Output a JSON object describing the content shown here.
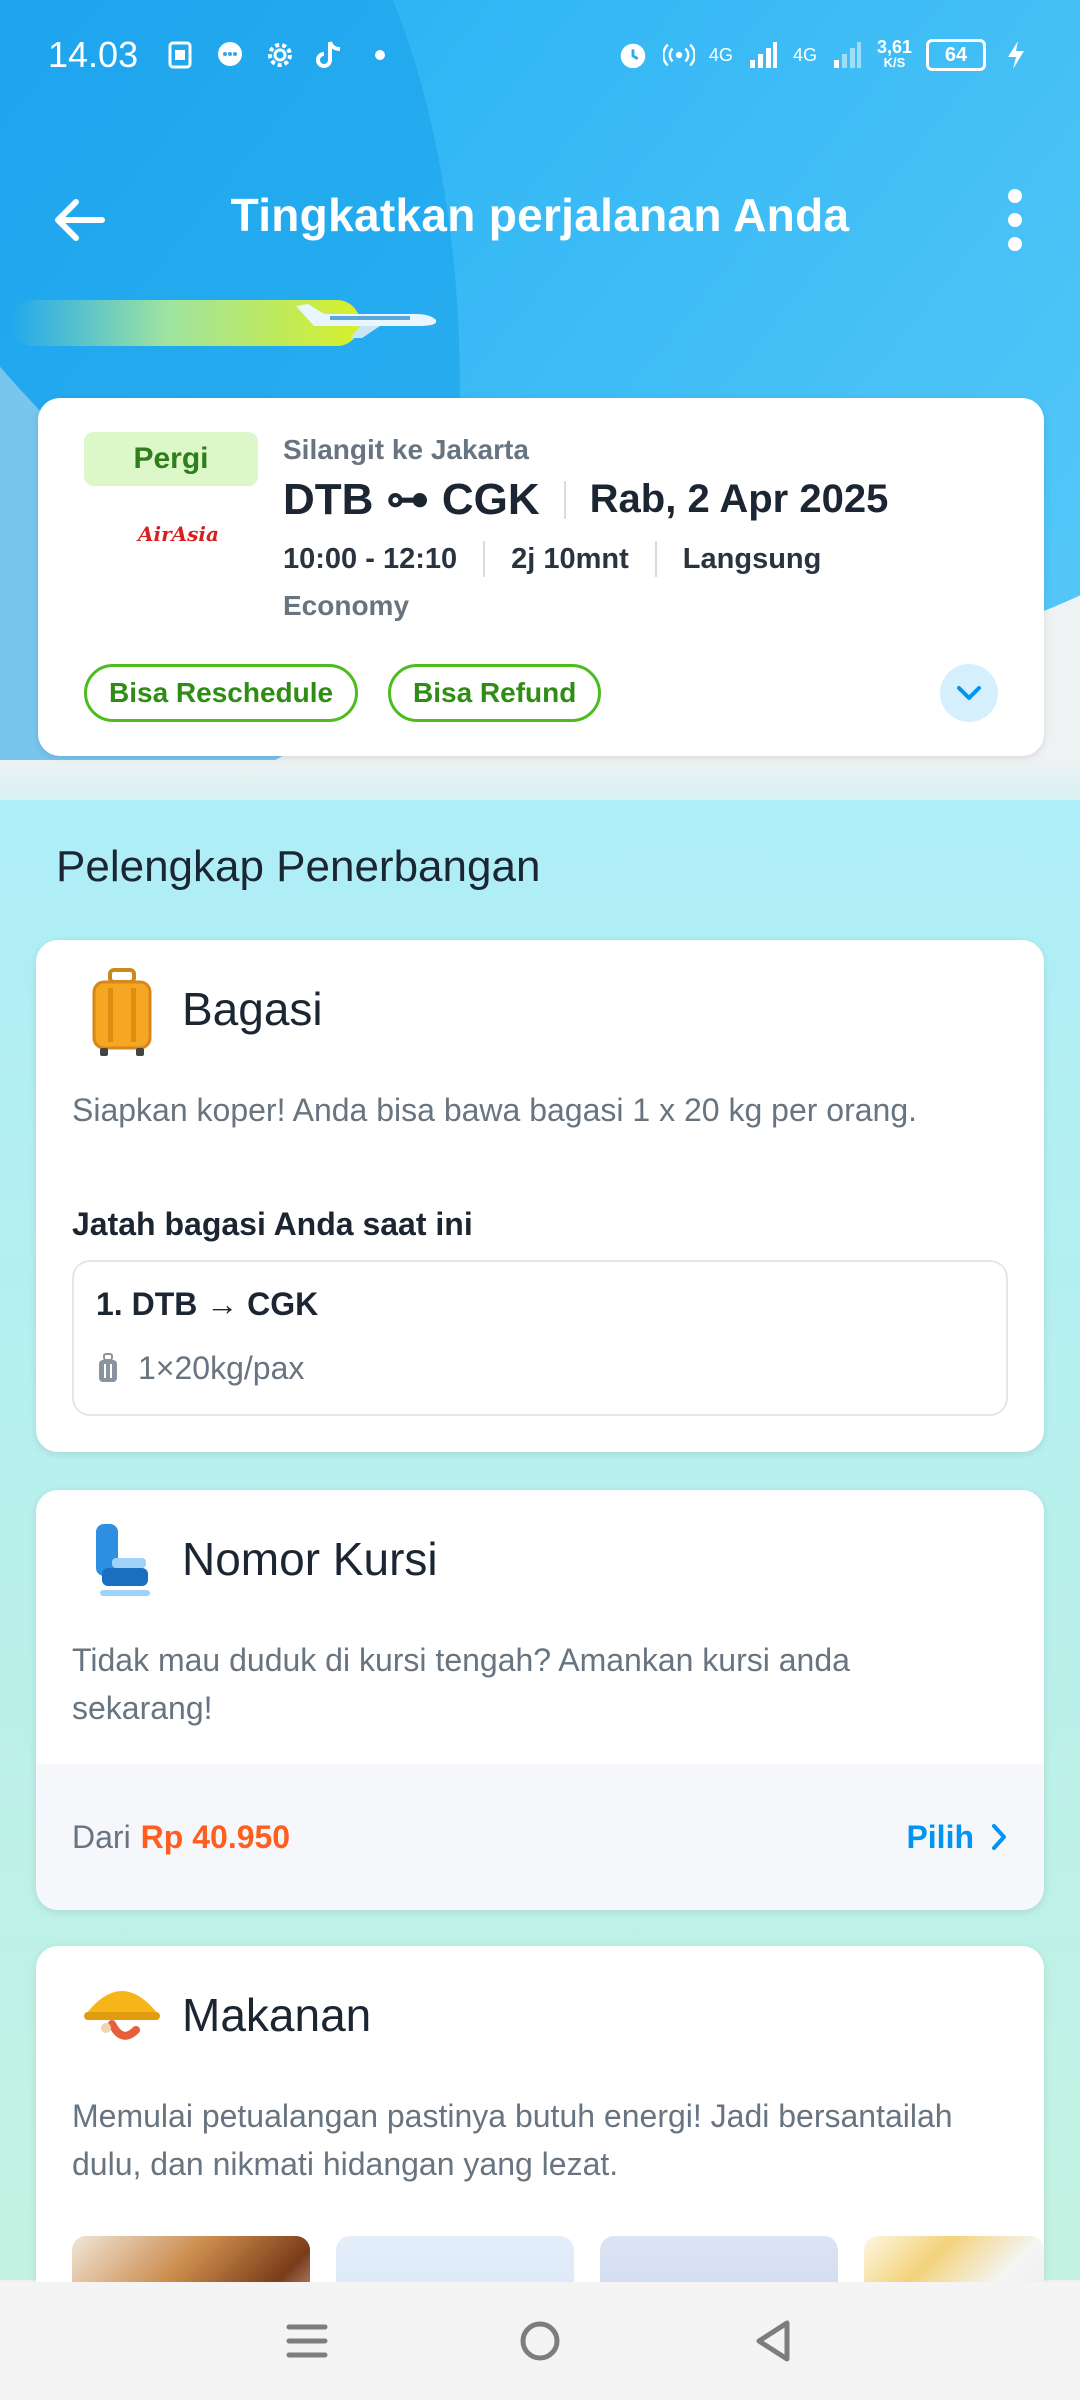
{
  "status_bar": {
    "time": "14.03",
    "network_1": "4G",
    "network_2": "4G",
    "speed_value": "3,61",
    "speed_unit": "K/S",
    "battery": "64"
  },
  "header": {
    "title": "Tingkatkan perjalanan Anda"
  },
  "flight": {
    "direction_badge": "Pergi",
    "airline_logo_text": "AirAsia",
    "route_sub": "Silangit ke Jakarta",
    "route": "DTB ⊶ CGK",
    "date": "Rab, 2 Apr 2025",
    "time": "10:00 - 12:10",
    "duration": "2j 10mnt",
    "stops": "Langsung",
    "cabin": "Economy",
    "tags": [
      "Bisa Reschedule",
      "Bisa Refund"
    ]
  },
  "section_title": "Pelengkap Penerbangan",
  "baggage": {
    "title": "Bagasi",
    "description": "Siapkan koper! Anda bisa bawa bagasi 1 x 20 kg per orang.",
    "allowance_heading": "Jatah bagasi Anda saat ini",
    "route": "1. DTB → CGK",
    "allowance": "1×20kg/pax"
  },
  "seat": {
    "title": "Nomor Kursi",
    "description": "Tidak mau duduk di kursi tengah? Amankan kursi anda sekarang!",
    "price_prefix": "Dari",
    "price": "Rp 40.950",
    "action": "Pilih"
  },
  "meal": {
    "title": "Makanan",
    "description": "Memulai petualangan pastinya butuh energi! Jadi bersantailah dulu, dan nikmati hidangan yang lezat."
  },
  "colors": {
    "primary_blue": "#0194f3",
    "price_orange": "#ff5e1f",
    "tag_green": "#4cbd1e"
  }
}
